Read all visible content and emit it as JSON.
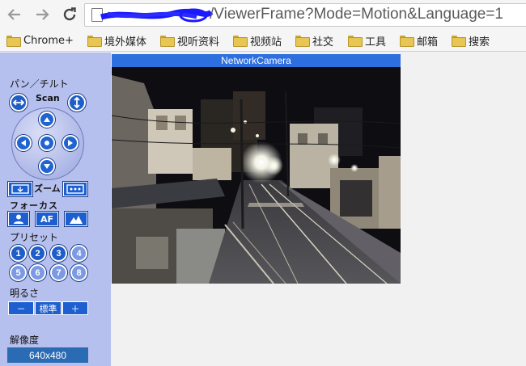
{
  "browser": {
    "url": "/ViewerFrame?Mode=Motion&Language=1",
    "bookmarks": [
      "Chrome+",
      "境外媒体",
      "视听资料",
      "视频站",
      "社交",
      "工具",
      "邮箱",
      "搜索"
    ]
  },
  "camera": {
    "title": "NetworkCamera"
  },
  "controls": {
    "pan_tilt_label": "パン／チルト",
    "scan_label": "Scan",
    "zoom_label": "ズーム",
    "focus_label": "フォーカス",
    "focus_af_label": "AF",
    "preset_label": "プリセット",
    "presets": [
      "1",
      "2",
      "3",
      "4",
      "5",
      "6",
      "7",
      "8"
    ],
    "brightness_label": "明るさ",
    "brightness_minus": "－",
    "brightness_standard": "標準",
    "brightness_plus": "＋",
    "resolution_label": "解像度",
    "resolution_value": "640x480"
  },
  "colors": {
    "sidebar_bg": "#b6c0ee",
    "button_blue": "#1f5ec8",
    "title_bar": "#2e6fe0"
  }
}
